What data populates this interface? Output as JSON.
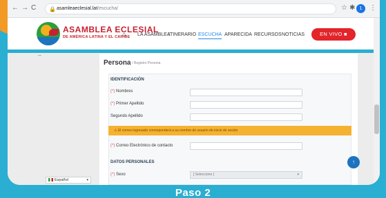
{
  "browser": {
    "url_domain": "asamleaeclesial.lat",
    "url_path": "/escucha/",
    "back_icon": "arrow-left-icon",
    "forward_icon": "arrow-right-icon",
    "reload_icon": "reload-icon",
    "bookmark_icon": "star-icon",
    "profile_letter": "1"
  },
  "header": {
    "logo_title": "ASAMBLEA ECLESIAL",
    "logo_subtitle": "DE AMÉRICA LATINA Y EL CARIBE",
    "nav": [
      "LA ASAMBLEA",
      "ITINERARIO",
      "ESCUCHA",
      "APARECIDA",
      "RECURSOS",
      "NOTICIAS"
    ],
    "active_nav": "ESCUCHA",
    "live_button": "EN VIVO ■",
    "accent_color": "#e3242b"
  },
  "page": {
    "dash": "--",
    "title": "Persona",
    "breadcrumb": "/ Registro Persona"
  },
  "form": {
    "section_identification": "IDENTIFICACIÓN",
    "nombres_label": "Nombres",
    "primer_apellido_label": "Primer Apellido",
    "segundo_apellido_label": "Segundo Apellido",
    "warning_text": "El correo ingresado corresponderá a su nombre de usuario de inicio de sesión",
    "correo_label": "Correo Electrónico de contacto",
    "section_personal": "DATOS PERSONALES",
    "sexo_label": "Sexo",
    "sexo_placeholder": "[ Seleccione ]",
    "required_mark": "(*)"
  },
  "language": {
    "selected": "Español"
  },
  "caption": "Paso 2"
}
